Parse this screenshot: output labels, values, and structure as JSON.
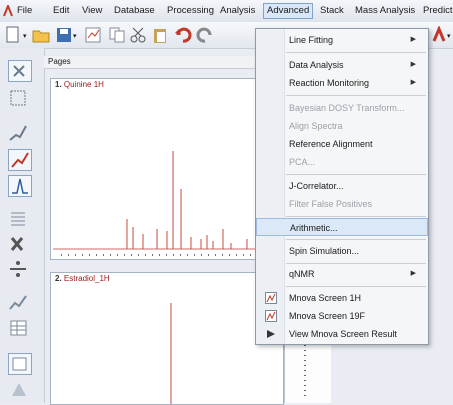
{
  "menubar": {
    "items": [
      "File",
      "Edit",
      "View",
      "Database",
      "Processing",
      "Analysis",
      "Advanced",
      "Stack",
      "Mass Analysis",
      "Predict"
    ]
  },
  "pages": {
    "header": "Pages",
    "panels": [
      {
        "index": "1.",
        "name": "Quinine 1H"
      },
      {
        "index": "2.",
        "name": "Estradiol_1H"
      }
    ],
    "view_tab": "1"
  },
  "dropdown": {
    "items": {
      "line_fitting": "Line Fitting",
      "data_analysis": "Data Analysis",
      "reaction_monitoring": "Reaction Monitoring",
      "bayesian": "Bayesian DOSY Transform...",
      "align": "Align Spectra",
      "reference": "Reference Alignment",
      "pca": "PCA...",
      "jcorrelator": "J-Correlator...",
      "filter": "Filter False Positives",
      "arithmetic": "Arithmetic...",
      "spin": "Spin Simulation...",
      "qnmr": "qNMR",
      "screen1h": "Mnova Screen 1H",
      "screen19f": "Mnova Screen 19F",
      "viewscreen": "View Mnova Screen Result"
    }
  },
  "colors": {
    "accent": "#7fa3cf",
    "spectrum": "#c0392b",
    "hover": "#dbe8f7"
  }
}
